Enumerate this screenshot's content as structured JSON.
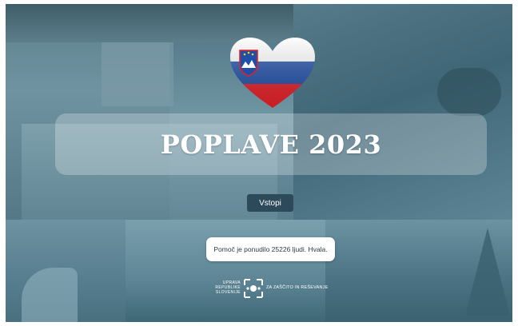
{
  "hero": {
    "title": "POPLAVE 2023"
  },
  "enter_button": {
    "label": "Vstopi"
  },
  "info": {
    "message": "Pomoč je ponudilo 25226 ljudi. Hvala."
  },
  "logo": {
    "left_lines": [
      "UPRAVA",
      "REPUBLIKE",
      "SLOVENIJE"
    ],
    "right_text": "ZA ZAŠČITO IN REŠEVANJE"
  },
  "flag_colors": {
    "white": "#ffffff",
    "blue": "#1f4fa8",
    "red": "#e32028"
  },
  "icons": {
    "heart": "heart-slovenian-flag-icon",
    "logo_mark": "civil-protection-logo-icon"
  }
}
